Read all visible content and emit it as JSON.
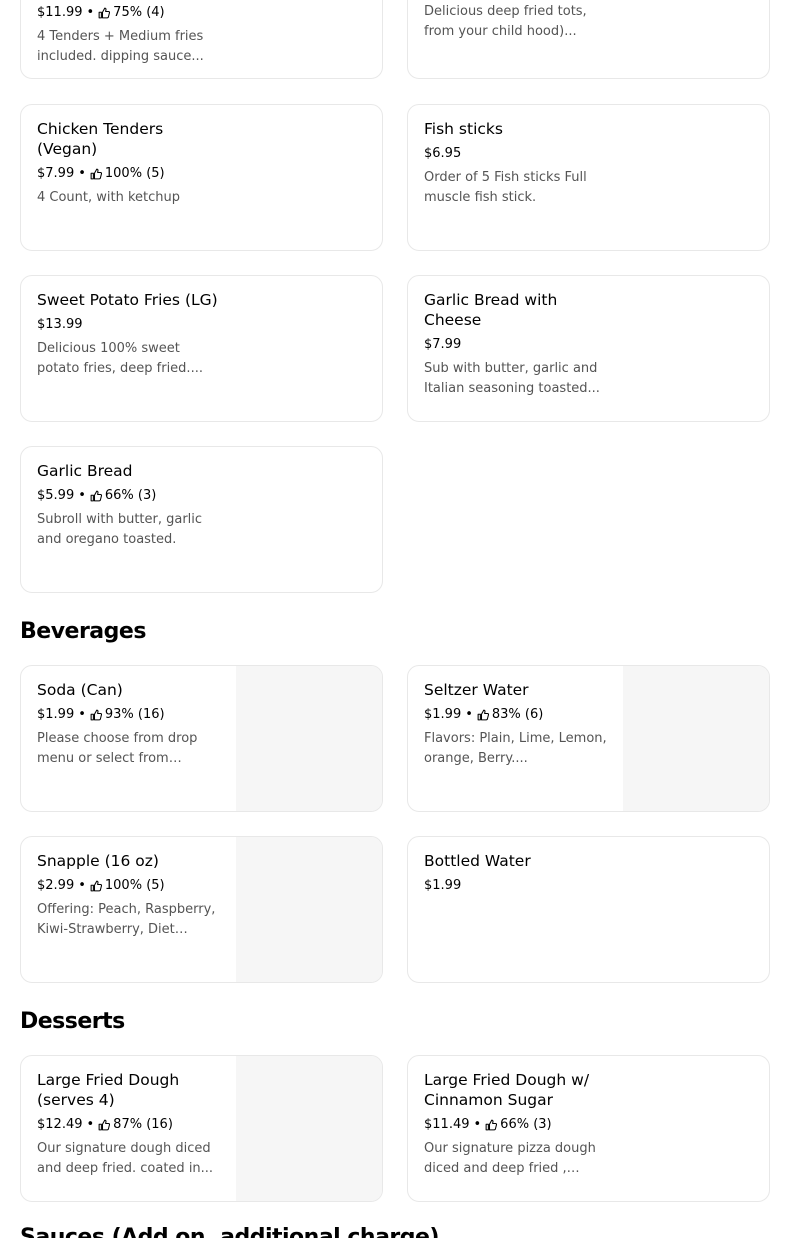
{
  "sections": {
    "beverages": "Beverages",
    "desserts": "Desserts",
    "sauces": "Sauces (Add on, additional charge)"
  },
  "items": {
    "chicken_tenders": {
      "price": "$11.99",
      "rating": "75% (4)",
      "desc": "4 Tenders + Medium fries included. dipping sauce..."
    },
    "tots": {
      "desc": "Delicious deep fried tots, from your child hood)..."
    },
    "chicken_tenders_vegan": {
      "title": "Chicken Tenders (Vegan)",
      "price": "$7.99",
      "rating": "100% (5)",
      "desc": "4 Count, with ketchup"
    },
    "fish_sticks": {
      "title": "Fish sticks",
      "price": "$6.95",
      "desc": "Order of 5 Fish sticks Full muscle fish stick."
    },
    "sweet_potato_fries": {
      "title": "Sweet Potato Fries (LG)",
      "price": "$13.99",
      "desc": "Delicious 100% sweet potato fries, deep fried...."
    },
    "garlic_bread_cheese": {
      "title": "Garlic Bread with Cheese",
      "price": "$7.99",
      "desc": "Sub with butter, garlic and Italian seasoning toasted..."
    },
    "garlic_bread": {
      "title": "Garlic Bread",
      "price": "$5.99",
      "rating": "66% (3)",
      "desc": "Subroll with butter, garlic and oregano toasted."
    },
    "soda": {
      "title": "Soda (Can)",
      "price": "$1.99",
      "rating": "93% (16)",
      "desc": "Please choose from drop menu or select from below..."
    },
    "seltzer": {
      "title": "Seltzer Water",
      "price": "$1.99",
      "rating": "83% (6)",
      "desc": "Flavors: Plain, Lime, Lemon, orange, Berry...."
    },
    "snapple": {
      "title": "Snapple (16 oz)",
      "price": "$2.99",
      "rating": "100% (5)",
      "desc": "Offering: Peach, Raspberry, Kiwi-Strawberry, Diet Peac..."
    },
    "bottled_water": {
      "title": "Bottled Water",
      "price": "$1.99"
    },
    "fried_dough": {
      "title": "Large Fried Dough (serves 4)",
      "price": "$12.49",
      "rating": "87% (16)",
      "desc": "Our signature dough diced and deep fried. coated in..."
    },
    "fried_dough_cinnamon": {
      "title": "Large Fried Dough w/ Cinnamon Sugar",
      "price": "$11.49",
      "rating": "66% (3)",
      "desc": "Our signature pizza dough diced and deep fried , dipp..."
    }
  },
  "icons": {
    "rating": "thumbs-up-icon"
  },
  "colors": {
    "border": "#e8e8e8",
    "description": "#545454",
    "thumbnail": "#f6f6f6"
  }
}
